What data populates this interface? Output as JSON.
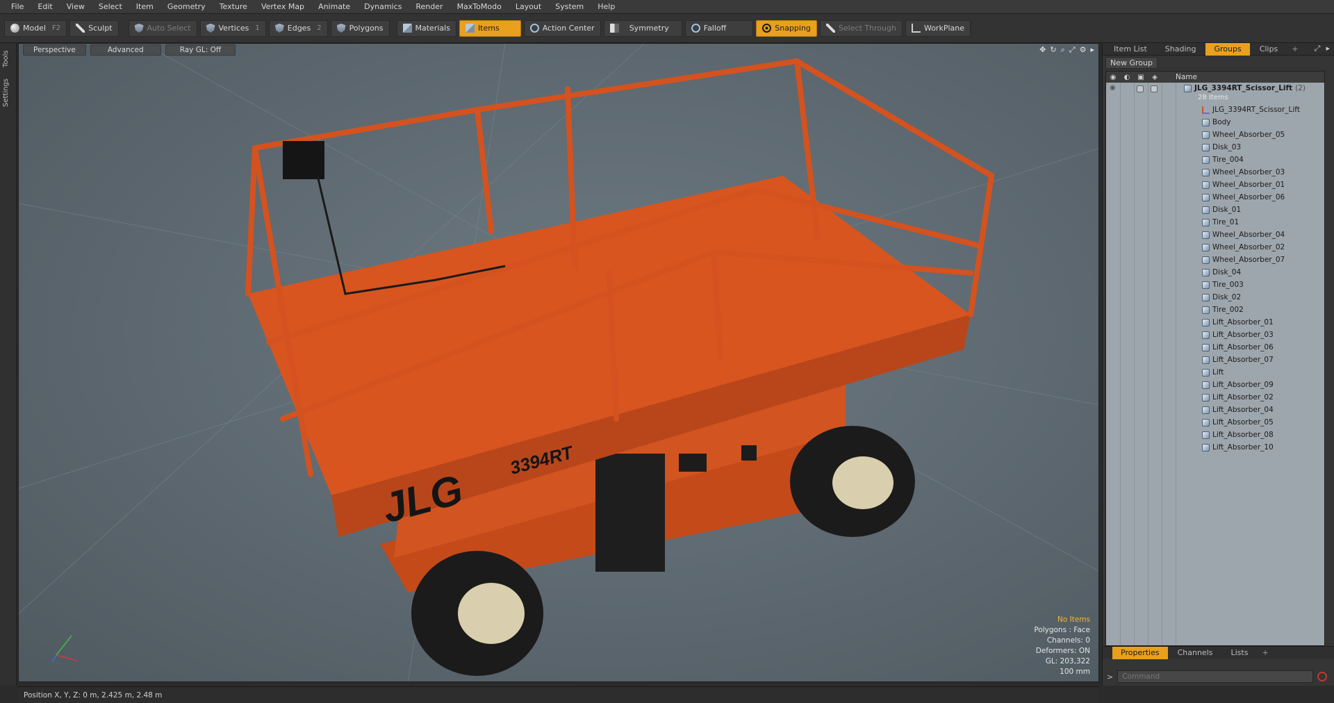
{
  "menu": [
    "File",
    "Edit",
    "View",
    "Select",
    "Item",
    "Geometry",
    "Texture",
    "Vertex Map",
    "Animate",
    "Dynamics",
    "Render",
    "MaxToModo",
    "Layout",
    "System",
    "Help"
  ],
  "toolbar": {
    "model": "Model",
    "model_key": "F2",
    "sculpt": "Sculpt",
    "auto_select": "Auto Select",
    "vertices": "Vertices",
    "vertices_key": "1",
    "edges": "Edges",
    "edges_key": "2",
    "polygons": "Polygons",
    "materials": "Materials",
    "items": "Items",
    "action_center": "Action Center",
    "symmetry": "Symmetry",
    "falloff": "Falloff",
    "snapping": "Snapping",
    "select_through": "Select Through",
    "workplane": "WorkPlane"
  },
  "left_tabs": [
    "Tools",
    "Settings"
  ],
  "viewport": {
    "view_mode": "Perspective",
    "shading": "Advanced",
    "raygl": "Ray GL: Off",
    "hud": [
      "No Items",
      "Polygons : Face",
      "Channels: 0",
      "Deformers: ON",
      "GL: 203,322",
      "100 mm"
    ],
    "model_text": {
      "brand": "JLG",
      "model_number": "3394RT"
    }
  },
  "status": "Position X, Y, Z:  0 m, 2.425 m, 2.48 m",
  "right_panel": {
    "tabs": [
      "Item List",
      "Shading",
      "Groups",
      "Clips"
    ],
    "active_tab": "Groups",
    "new_group": "New Group",
    "column_name": "Name",
    "group": {
      "name": "JLG_3394RT_Scissor_Lift",
      "count": "(2)",
      "sub": "28 Items"
    },
    "items": [
      "JLG_3394RT_Scissor_Lift",
      "Body",
      "Wheel_Absorber_05",
      "Disk_03",
      "Tire_004",
      "Wheel_Absorber_03",
      "Wheel_Absorber_01",
      "Wheel_Absorber_06",
      "Disk_01",
      "Tire_01",
      "Wheel_Absorber_04",
      "Wheel_Absorber_02",
      "Wheel_Absorber_07",
      "Disk_04",
      "Tire_003",
      "Disk_02",
      "Tire_002",
      "Lift_Absorber_01",
      "Lift_Absorber_03",
      "Lift_Absorber_06",
      "Lift_Absorber_07",
      "Lift",
      "Lift_Absorber_09",
      "Lift_Absorber_02",
      "Lift_Absorber_04",
      "Lift_Absorber_05",
      "Lift_Absorber_08",
      "Lift_Absorber_10"
    ],
    "bottom_tabs": [
      "Properties",
      "Channels",
      "Lists"
    ],
    "command_placeholder": "Command"
  },
  "colors": {
    "accent": "#e9a01c",
    "lift_orange": "#d9531f",
    "viewport_bg": "#5f6b73"
  }
}
